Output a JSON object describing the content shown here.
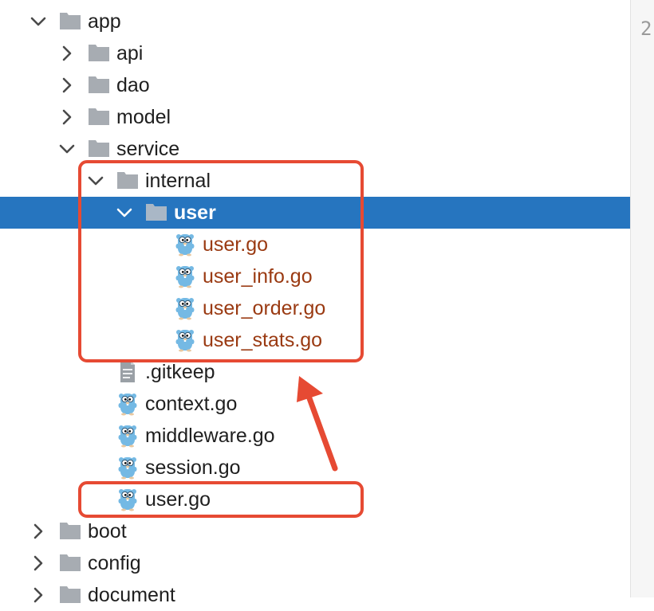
{
  "tree": {
    "items": [
      {
        "label": "app",
        "type": "folder",
        "state": "expanded"
      },
      {
        "label": "api",
        "type": "folder",
        "state": "collapsed"
      },
      {
        "label": "dao",
        "type": "folder",
        "state": "collapsed"
      },
      {
        "label": "model",
        "type": "folder",
        "state": "collapsed"
      },
      {
        "label": "service",
        "type": "folder",
        "state": "expanded"
      },
      {
        "label": "internal",
        "type": "folder",
        "state": "expanded"
      },
      {
        "label": "user",
        "type": "folder",
        "state": "expanded",
        "selected": true
      },
      {
        "label": "user.go",
        "type": "go-file",
        "modified": true
      },
      {
        "label": "user_info.go",
        "type": "go-file",
        "modified": true
      },
      {
        "label": "user_order.go",
        "type": "go-file",
        "modified": true
      },
      {
        "label": "user_stats.go",
        "type": "go-file",
        "modified": true
      },
      {
        "label": ".gitkeep",
        "type": "text-file"
      },
      {
        "label": "context.go",
        "type": "go-file"
      },
      {
        "label": "middleware.go",
        "type": "go-file"
      },
      {
        "label": "session.go",
        "type": "go-file"
      },
      {
        "label": "user.go",
        "type": "go-file"
      },
      {
        "label": "boot",
        "type": "folder",
        "state": "collapsed"
      },
      {
        "label": "config",
        "type": "folder",
        "state": "collapsed"
      },
      {
        "label": "document",
        "type": "folder",
        "state": "collapsed"
      }
    ]
  },
  "gutter": {
    "line_number": "2"
  },
  "colors": {
    "selection": "#2675bf",
    "folder": "#a7acb2",
    "modified_text": "#9a3a12",
    "gopher": "#74b9e4",
    "annotation": "#e64a33"
  },
  "annotations": {
    "highlight_boxes": [
      "internal-folder-group",
      "moved-user-go-file"
    ],
    "arrow": "from-bottom-box-to-top-box"
  }
}
